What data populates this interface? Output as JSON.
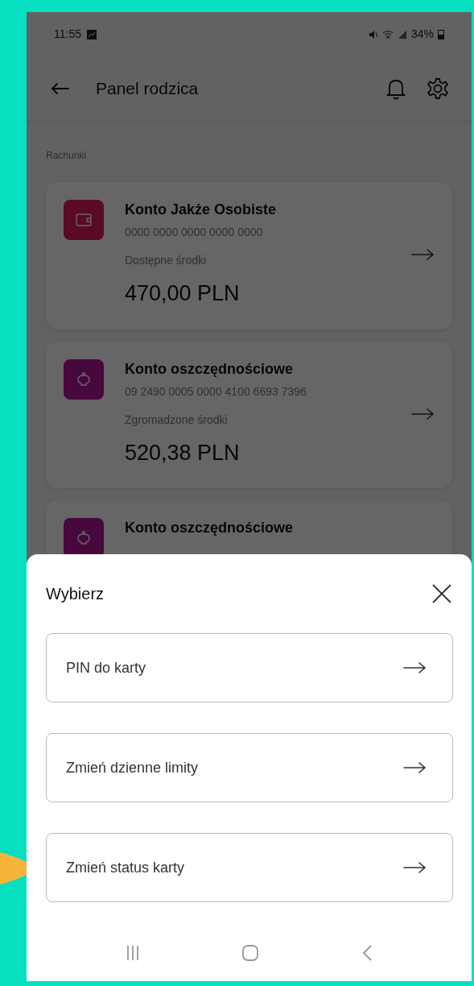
{
  "status_bar": {
    "time": "11:55",
    "battery": "34%"
  },
  "header": {
    "title": "Panel rodzica"
  },
  "section": {
    "label": "Rachunki"
  },
  "accounts": [
    {
      "kind": "wallet",
      "name": "Konto Jakże Osobiste",
      "number": "0000 0000 0000 0000 0000",
      "balance_label": "Dostępne środki",
      "balance": "470,00 PLN"
    },
    {
      "kind": "piggy",
      "name": "Konto oszczędnościowe",
      "number": "09 2490 0005 0000 4100 6693 7396",
      "balance_label": "Zgromadzone środki",
      "balance": "520,38 PLN"
    },
    {
      "kind": "piggy",
      "name": "Konto oszczędnościowe"
    }
  ],
  "sheet": {
    "title": "Wybierz",
    "options": [
      {
        "label": "PIN do karty"
      },
      {
        "label": "Zmień dzienne limity"
      },
      {
        "label": "Zmień status karty"
      }
    ]
  }
}
